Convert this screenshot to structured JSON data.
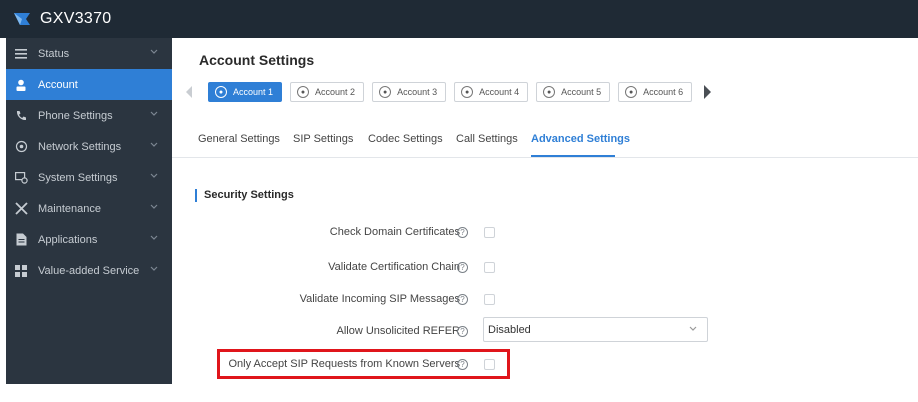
{
  "app": {
    "name": "GXV3370"
  },
  "colors": {
    "accent": "#2f7fd6",
    "sidebar_bg": "#2b3540",
    "topbar_bg": "#1f2a35",
    "highlight": "#e0151b"
  },
  "sidebar": {
    "items": [
      {
        "label": "Status",
        "icon": "list-icon",
        "has_chevron": true,
        "active": false
      },
      {
        "label": "Account",
        "icon": "person-icon",
        "has_chevron": false,
        "active": true
      },
      {
        "label": "Phone Settings",
        "icon": "phone-icon",
        "has_chevron": true,
        "active": false
      },
      {
        "label": "Network Settings",
        "icon": "network-icon",
        "has_chevron": true,
        "active": false
      },
      {
        "label": "System Settings",
        "icon": "system-icon",
        "has_chevron": true,
        "active": false
      },
      {
        "label": "Maintenance",
        "icon": "tools-icon",
        "has_chevron": true,
        "active": false
      },
      {
        "label": "Applications",
        "icon": "document-icon",
        "has_chevron": true,
        "active": false
      },
      {
        "label": "Value-added Service",
        "icon": "grid-icon",
        "has_chevron": true,
        "active": false
      }
    ]
  },
  "main": {
    "title": "Account Settings",
    "accounts": [
      "Account 1",
      "Account 2",
      "Account 3",
      "Account 4",
      "Account 5",
      "Account 6"
    ],
    "active_account": 0,
    "tabs": [
      "General Settings",
      "SIP Settings",
      "Codec Settings",
      "Call Settings",
      "Advanced Settings"
    ],
    "active_tab": 4,
    "section_title": "Security Settings",
    "fields": [
      {
        "label": "Check Domain Certificates",
        "type": "checkbox",
        "checked": false
      },
      {
        "label": "Validate Certification Chain",
        "type": "checkbox",
        "checked": false
      },
      {
        "label": "Validate Incoming SIP Messages",
        "type": "checkbox",
        "checked": false
      },
      {
        "label": "Allow Unsolicited REFER",
        "type": "select",
        "value": "Disabled"
      },
      {
        "label": "Only Accept SIP Requests from Known Servers",
        "type": "checkbox",
        "checked": false,
        "highlighted": true
      }
    ]
  }
}
